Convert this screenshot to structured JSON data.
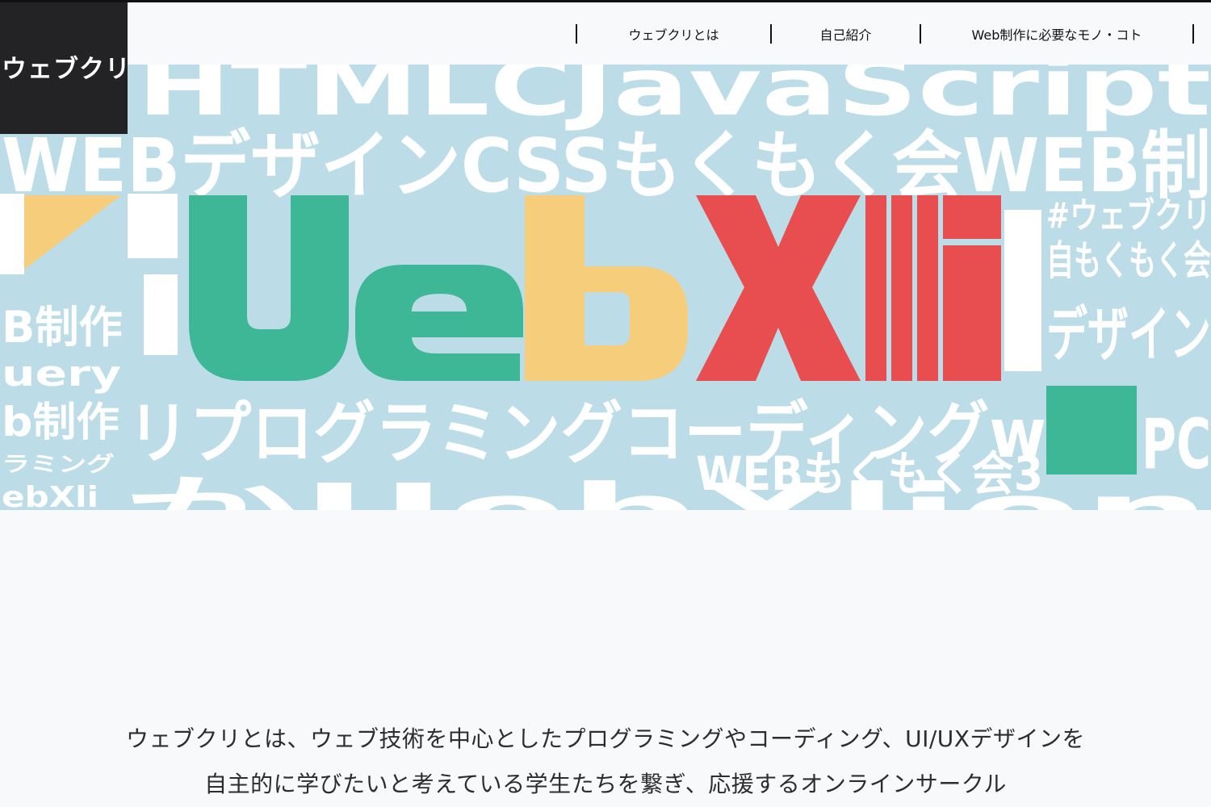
{
  "header": {
    "logo_text": "ウェブクリ",
    "nav": [
      {
        "label": "ウェブクリとは"
      },
      {
        "label": "自己紹介"
      },
      {
        "label": "Web制作に必要なモノ・コト"
      }
    ]
  },
  "hero": {
    "logo": {
      "letters": [
        "U",
        "e",
        "b",
        "X",
        "l",
        "i"
      ],
      "colors": {
        "green": "#3db795",
        "yellow": "#f6cd7b",
        "red": "#e84d50"
      }
    },
    "background_color": "#bcdde7",
    "words": {
      "row1": "HTMLCJavaScript",
      "row2": "WEBデザインCSSもくもく会WEB制",
      "row3": "リプログラミングコーディングw",
      "row4": "WEBもくもく会3",
      "row5": "かUebXlion",
      "left1": "B制作",
      "left2": "uery",
      "left3": "b制作",
      "left4": "ラミング",
      "left5": "ebXli",
      "right1": "#ウェブクリ",
      "right2": "自もくもく会",
      "right3": "デザイン",
      "right4": "PC"
    }
  },
  "intro": {
    "text": "ウェブクリとは、ウェブ技術を中心としたプログラミングやコーディング、UI/UXデザインを自主的に学びたいと考えている学生たちを繋ぎ、応援するオンラインサークル"
  }
}
